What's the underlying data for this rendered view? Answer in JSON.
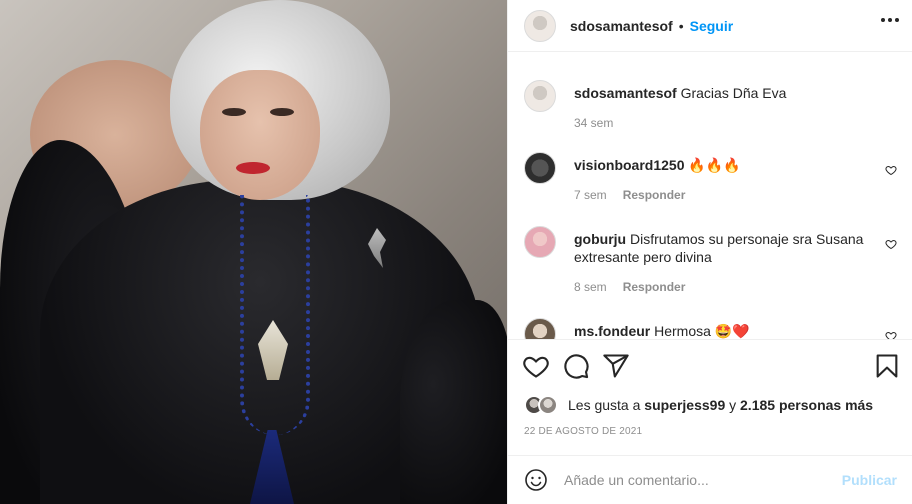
{
  "header": {
    "username": "sdosamantesof",
    "separator": "•",
    "follow_label": "Seguir",
    "more_icon": "more-options-icon"
  },
  "caption": {
    "user": "sdosamantesof",
    "text": "Gracias Dña Eva",
    "time": "34 sem"
  },
  "comments": [
    {
      "user": "visionboard1250",
      "text": "🔥🔥🔥",
      "time": "7 sem",
      "reply": "Responder"
    },
    {
      "user": "goburju",
      "text": "Disfrutamos su personaje sra Susana extresante pero divina",
      "time": "8 sem",
      "reply": "Responder"
    },
    {
      "user": "ms.fondeur",
      "text": "Hermosa 🤩❤️"
    }
  ],
  "likes": {
    "prefix": "Les gusta a",
    "user": "superjess99",
    "connector": "y",
    "others": "2.185 personas más"
  },
  "date": "22 DE AGOSTO DE 2021",
  "composer": {
    "placeholder": "Añade un comentario...",
    "post_label": "Publicar"
  },
  "colors": {
    "accent": "#0095f6",
    "post_disabled": "#b2dffc",
    "secondary_text": "#8e8e8e"
  }
}
